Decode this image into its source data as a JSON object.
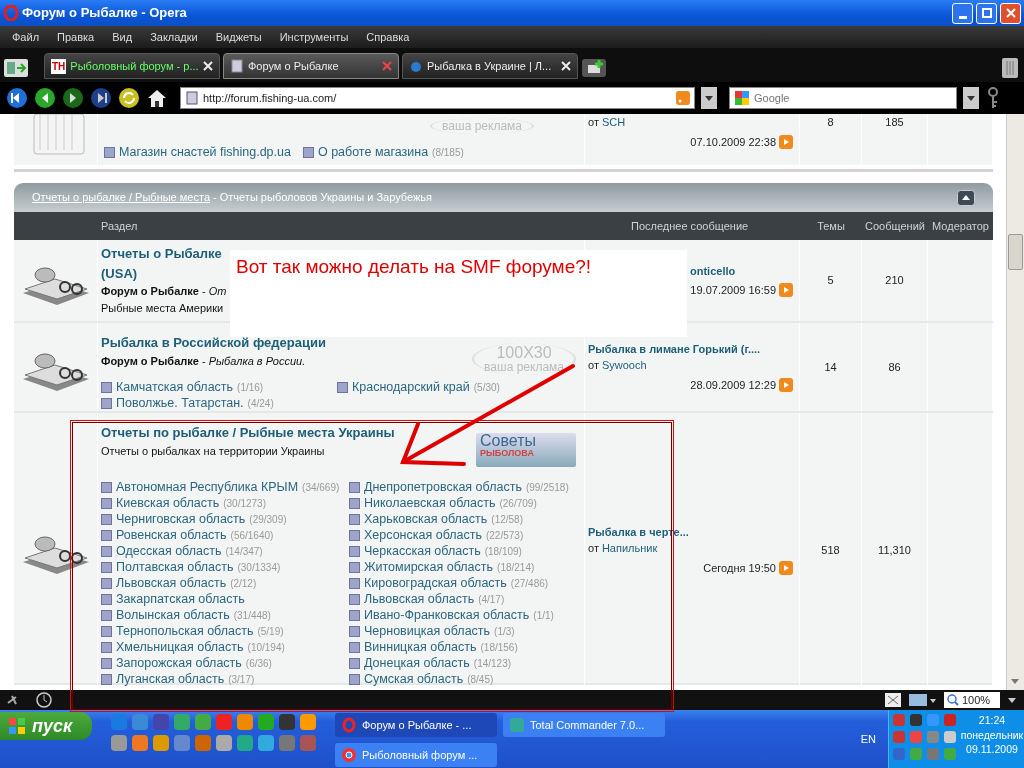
{
  "window": {
    "title": "Форум о Рыбалке - Opera"
  },
  "menu": [
    "Файл",
    "Правка",
    "Вид",
    "Закладки",
    "Виджеты",
    "Инструменты",
    "Справка"
  ],
  "tabs": [
    {
      "label": "Рыболовный форум - р...",
      "selected": false,
      "kind": "letters",
      "badge": "TH"
    },
    {
      "label": "Форум о Рыбалке",
      "selected": true,
      "kind": "page"
    },
    {
      "label": "Рыбалка в Украине | Л...",
      "selected": false,
      "kind": "drop"
    }
  ],
  "address": {
    "url": "http://forum.fishing-ua.com/"
  },
  "search": {
    "placeholder": "Google"
  },
  "top_row": {
    "ad": [
      "ваша реклама"
    ],
    "by": "от",
    "user": "SCH",
    "date": "07.10.2009 22:38",
    "topics": "8",
    "posts": "185",
    "subboards": [
      {
        "name": "Магазин снастей fishing.dp.ua"
      },
      {
        "name": "О работе магазина",
        "count": "(8/185)"
      }
    ]
  },
  "category": {
    "link": "Отчеты о рыбалке / Рыбные места",
    "text": " - Отчеты рыболовов  Украины и Зарубежья"
  },
  "columns": [
    "Раздел",
    "Последнее сообщение",
    "Темы",
    "Сообщений",
    "Модератор"
  ],
  "boards": [
    {
      "title": "Отчеты о Рыбалке (USA)",
      "moderator": "**Форум о Рыбалке** - *От*",
      "extra": "Рыбные места Америки",
      "last_subject": "onticello",
      "date": "19.07.2009 16:59",
      "topics": "5",
      "posts": "210"
    },
    {
      "title": "Рыбалка в Российской федерации",
      "moderator": "**Форум о Рыбалке** - *Рыбалка в России.*",
      "ad": [
        "100X30",
        "ваша реклама"
      ],
      "subboards": [
        {
          "name": "Камчатская область",
          "count": "(1/16)"
        },
        {
          "name": "Поволжье. Татарстан.",
          "count": "(4/24)"
        },
        {
          "name": "Краснодарский край",
          "count": "(5/30)"
        }
      ],
      "last_subject": "Рыбалка в лимане Горький (г....",
      "by": "от",
      "user": "Sywooch",
      "date": "28.09.2009 12:29",
      "topics": "14",
      "posts": "86"
    },
    {
      "title": "Отчеты по рыбалке / Рыбные места Украины",
      "extra": "Отчеты о рыбалках на территории Украины",
      "banner": [
        "Советы",
        "РЫБОЛОВА"
      ],
      "subboards": [
        {
          "name": "Автономная Республика КРЫМ",
          "count": "(34/669)"
        },
        {
          "name": "Киевская область",
          "count": "(30/1273)"
        },
        {
          "name": "Черниговская область",
          "count": "(29/309)"
        },
        {
          "name": "Ровенская область",
          "count": "(56/1640)"
        },
        {
          "name": "Одесская область",
          "count": "(14/347)"
        },
        {
          "name": "Полтавская область",
          "count": "(30/1334)"
        },
        {
          "name": "Львовская область",
          "count": "(2/12)"
        },
        {
          "name": "Закарпатская область"
        },
        {
          "name": "Волынская область",
          "count": "(31/448)"
        },
        {
          "name": "Тернопольская область",
          "count": "(5/19)"
        },
        {
          "name": "Хмельницкая область",
          "count": "(10/194)"
        },
        {
          "name": "Запорожская область",
          "count": "(6/36)"
        },
        {
          "name": "Луганская область",
          "count": "(3/17)"
        },
        {
          "name": "Днепропетровская область",
          "count": "(99/2518)"
        },
        {
          "name": "Николаевская область",
          "count": "(26/709)"
        },
        {
          "name": "Харьковская область",
          "count": "(12/58)"
        },
        {
          "name": "Херсонская область",
          "count": "(22/573)"
        },
        {
          "name": "Черкасская область",
          "count": "(18/109)"
        },
        {
          "name": "Житомирская область",
          "count": "(18/214)"
        },
        {
          "name": "Кировоградская область",
          "count": "(27/486)"
        },
        {
          "name": "Львовская область",
          "count": "(4/17)"
        },
        {
          "name": "Ивано-Франковская область",
          "count": "(1/1)"
        },
        {
          "name": "Черновицкая область",
          "count": "(1/3)"
        },
        {
          "name": "Винницкая область",
          "count": "(18/156)"
        },
        {
          "name": "Донецкая область",
          "count": "(14/123)"
        },
        {
          "name": "Сумская область",
          "count": "(8/45)"
        }
      ],
      "last_subject": "Рыбалка в черте...",
      "by": "от",
      "user": "Напильник",
      "date": "Сегодня 19:50",
      "topics": "518",
      "posts": "11,310"
    }
  ],
  "annotation": {
    "text": "Вот так можно делать на SMF форуме?!"
  },
  "status_bar": {
    "zoom": "100%"
  },
  "taskbar": {
    "start": "пуск",
    "windows": [
      {
        "label": "Форум о Рыбалке - ...",
        "selected": true,
        "kind": "opera"
      },
      {
        "label": "Total Commander 7.0...",
        "selected": false,
        "kind": "tc"
      },
      {
        "label": "Рыболовный форум ...",
        "selected": false,
        "kind": "chrome"
      }
    ],
    "language": "EN",
    "time": "21:24",
    "day": "понедельник",
    "date": "09.11.2009"
  }
}
